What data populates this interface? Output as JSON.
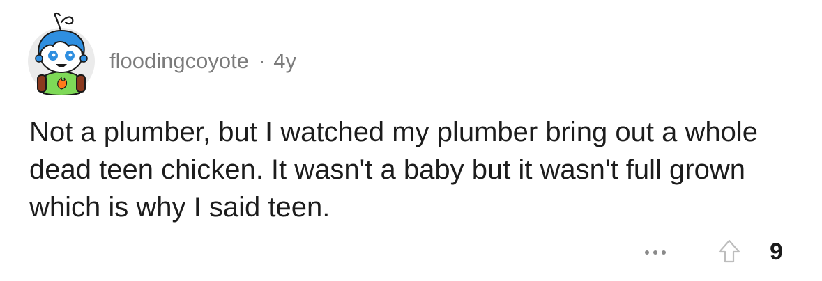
{
  "comment": {
    "author": "floodingcoyote",
    "separator": "·",
    "age": "4y",
    "text": "Not a plumber, but I watched my plumber bring out a whole dead teen chicken. It wasn't a baby but it wasn't full grown which is why I said teen.",
    "score": "9",
    "icons": {
      "avatar": "snoo-avatar-icon",
      "more": "more-options-icon",
      "upvote": "upvote-arrow-icon"
    },
    "colors": {
      "username": "#7c7c7c",
      "text": "#1c1c1c",
      "avatar_hair": "#2f8fe0",
      "avatar_shirt": "#7ed957"
    }
  }
}
